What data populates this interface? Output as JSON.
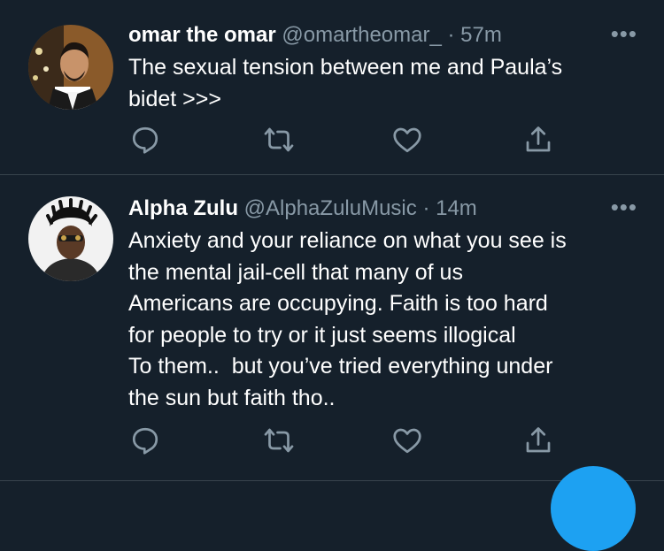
{
  "tweets": [
    {
      "display_name": "omar the omar",
      "handle": "@omartheomar_",
      "separator": "·",
      "time": "57m",
      "more_label": "•••",
      "text": "The sexual tension between me and Paula’s\nbidet >>>"
    },
    {
      "display_name": "Alpha Zulu",
      "handle": "@AlphaZuluMusic",
      "separator": "·",
      "time": "14m",
      "more_label": "•••",
      "text": "Anxiety and your reliance on what you see is\nthe mental jail-cell that many of us\nAmericans are occupying. Faith is too hard\nfor people to try or it just seems illogical\nTo them..  but you’ve tried everything under\nthe sun but faith tho.."
    }
  ],
  "actions": [
    "reply-icon",
    "retweet-icon",
    "like-icon",
    "share-icon"
  ],
  "colors": {
    "background": "#15202b",
    "text": "#ffffff",
    "secondary": "#8899a6",
    "divider": "#38444d",
    "accent": "#1da1f2"
  }
}
